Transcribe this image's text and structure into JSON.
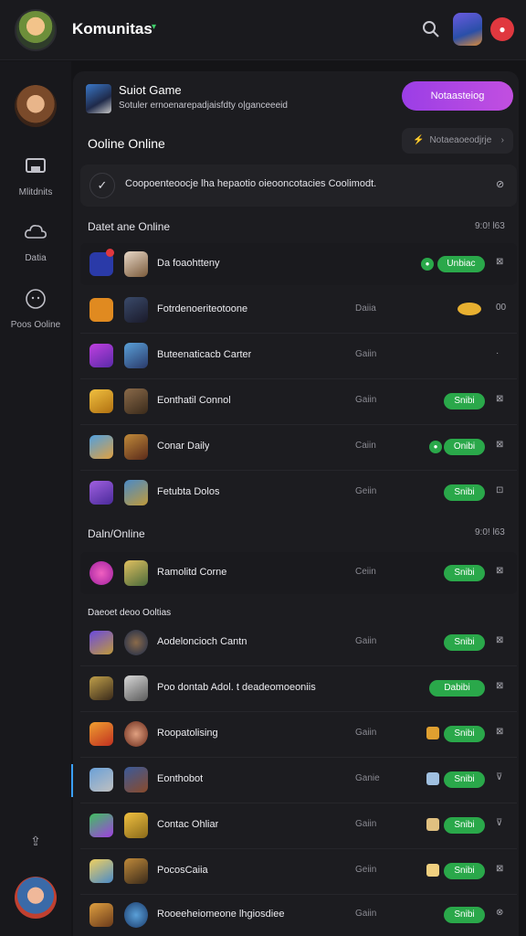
{
  "header": {
    "title": "Komunitas"
  },
  "sidebar": {
    "items": [
      {
        "label": "Mlitdnits",
        "icon": "controller-icon"
      },
      {
        "label": "Datia",
        "icon": "cloud-icon"
      },
      {
        "label": "Poos Ooline",
        "icon": "chat-bubble-icon"
      }
    ]
  },
  "hero": {
    "title": "Suiot Game",
    "subtitle": "Sotuler ernoenarepadjaisfdty o|ganceeeid",
    "button": "Notaasteiog"
  },
  "section_online": {
    "title": "Ooline Online",
    "filter": "Notaeaoeodjrje",
    "notice": "Coopoenteoocje lha hepaotio oieooncotacies Coolimodt."
  },
  "groups": [
    {
      "label": "Datet ane Online",
      "time": "9:0! l63"
    },
    {
      "label": "Daln/Online",
      "time": "9:0! l63"
    },
    {
      "label": "Daeoet deoo Ooltias",
      "time": ""
    }
  ],
  "rows": [
    {
      "name": "Da foaohtteny",
      "status": "",
      "badge": "Unbiac",
      "end": "⊠"
    },
    {
      "name": "Fotrdenoeriteotoone",
      "status": "Daiia",
      "badge": "",
      "end": "00"
    },
    {
      "name": "Buteenaticacb Carter",
      "status": "Gaiin",
      "badge": "",
      "end": "·"
    },
    {
      "name": "Eonthatil Connol",
      "status": "Gaiin",
      "badge": "Snibi",
      "end": "⊠"
    },
    {
      "name": "Conar Daily",
      "status": "Caiin",
      "badge": "Onibi",
      "end": "⊠"
    },
    {
      "name": "Fetubta Dolos",
      "status": "Geiin",
      "badge": "Snibi",
      "end": "⊡"
    },
    {
      "name": "Ramolitd Corne",
      "status": "Ceiin",
      "badge": "Snibi",
      "end": "⊠"
    },
    {
      "name": "Aodeloncioch Cantn",
      "status": "Gaiin",
      "badge": "Snibi",
      "end": "⊠"
    },
    {
      "name": "Poo dontab Adol. t deadeomoeoniis",
      "status": "",
      "badge": "Dabibi",
      "end": "⊠"
    },
    {
      "name": "Roopatolising",
      "status": "Gaiin",
      "badge": "Snibi",
      "end": "⊠"
    },
    {
      "name": "Eonthobot",
      "status": "Ganie",
      "badge": "Snibi",
      "end": "⊽"
    },
    {
      "name": "Contac Ohliar",
      "status": "Gaiin",
      "badge": "Snibi",
      "end": "⊽"
    },
    {
      "name": "PocosCaiia",
      "status": "Geiin",
      "badge": "Snibi",
      "end": "⊠"
    },
    {
      "name": "Rooeeheiomeone lhgiosdiee",
      "status": "Gaiin",
      "badge": "Snibi",
      "end": "⊗"
    }
  ],
  "colors": {
    "accent_purple": "#b04ae6",
    "online_green": "#2aa84a",
    "alert_red": "#e0383f"
  }
}
